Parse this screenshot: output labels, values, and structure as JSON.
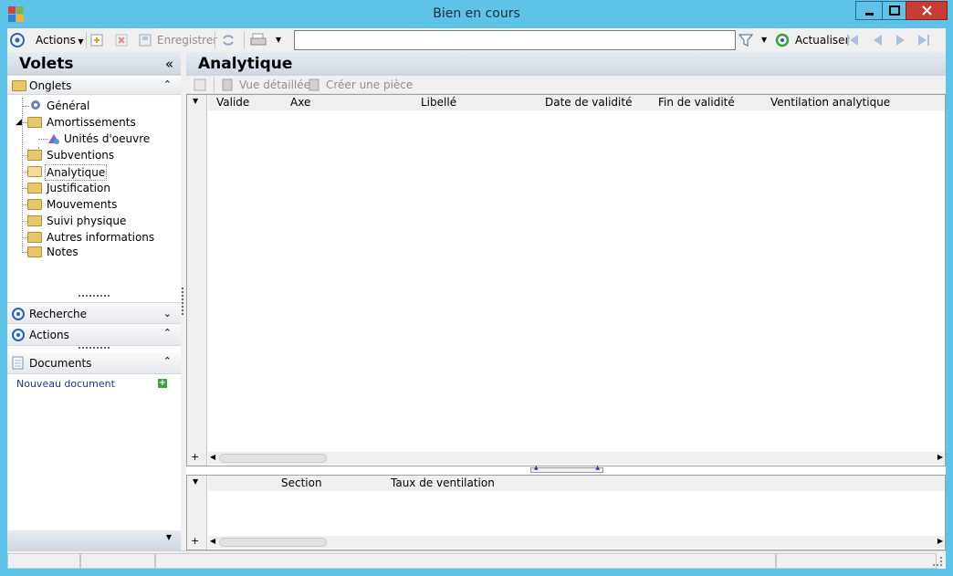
{
  "window": {
    "title": "Bien en cours",
    "minimize": "▁",
    "maximize": "□",
    "close": "✕"
  },
  "toolbar": {
    "actions_label": "Actions",
    "save_label": "Enregistrer",
    "search_value": "",
    "refresh_label": "Actualiser"
  },
  "left": {
    "title": "Volets",
    "collapse_glyph": "«",
    "onglets_label": "Onglets",
    "tree": [
      {
        "label": "Général"
      },
      {
        "label": "Amortissements"
      },
      {
        "label": "Unités d'oeuvre"
      },
      {
        "label": "Subventions"
      },
      {
        "label": "Analytique"
      },
      {
        "label": "Justification"
      },
      {
        "label": "Mouvements"
      },
      {
        "label": "Suivi physique"
      },
      {
        "label": "Autres informations"
      },
      {
        "label": "Notes"
      }
    ],
    "recherche_label": "Recherche",
    "actions_label": "Actions",
    "documents_label": "Documents",
    "new_document_label": "Nouveau document",
    "new_document_plus": "+"
  },
  "main": {
    "title": "Analytique",
    "toolbar": {
      "detail_label": "Vue détaillée",
      "create_label": "Créer une pièce"
    },
    "grid1": {
      "columns": [
        "Valide",
        "Axe",
        "Libellé",
        "Date de validité",
        "Fin de validité",
        "Ventilation analytique"
      ]
    },
    "grid2": {
      "columns": [
        "Section",
        "Taux de ventilation"
      ]
    },
    "add_glyph": "+"
  },
  "colors": {
    "titlebar": "#5fc2e9",
    "close": "#c73c35",
    "link": "#1a3a8c"
  }
}
